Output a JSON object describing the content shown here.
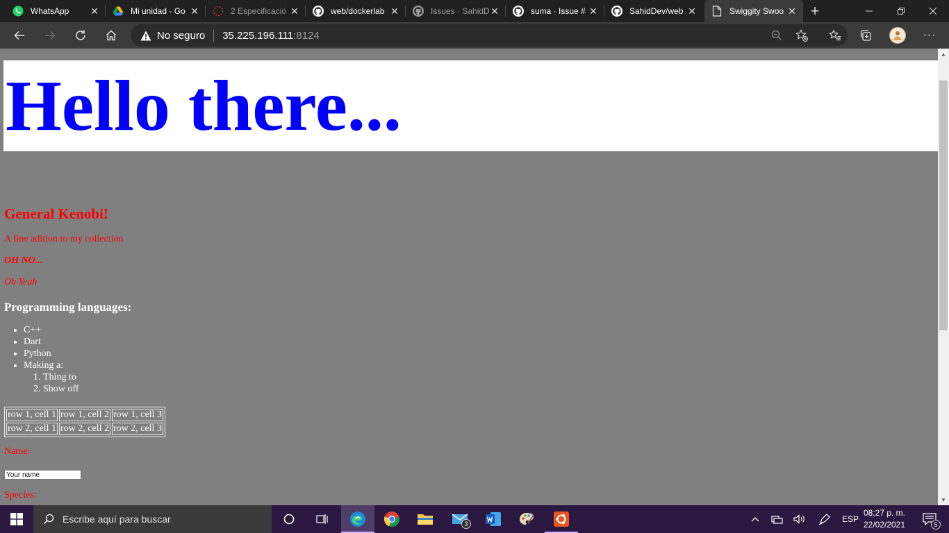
{
  "tabs": [
    {
      "title": "WhatsApp",
      "icon": "whatsapp-icon"
    },
    {
      "title": "Mi unidad - Go",
      "icon": "google-drive-icon"
    },
    {
      "title": "2 Especificació",
      "icon": "loading-spinner-icon"
    },
    {
      "title": "web/dockerlab",
      "icon": "github-icon"
    },
    {
      "title": "Issues · SahidD",
      "icon": "github-icon"
    },
    {
      "title": "suma · Issue #",
      "icon": "github-icon"
    },
    {
      "title": "SahidDev/web",
      "icon": "github-icon"
    },
    {
      "title": "Swiggity Swoo",
      "icon": "page-icon"
    }
  ],
  "address_bar": {
    "security_label": "No seguro",
    "url_host": "35.225.196.111",
    "url_port": ":8124"
  },
  "page": {
    "heading": "Hello there...",
    "subheading": "General Kenobi!",
    "paragraph1": "A fine adition to my collection",
    "paragraph2": "OH NO...",
    "paragraph3": "Oh Yeah",
    "languages_title": "Programming languages:",
    "languages": [
      "C++",
      "Dart",
      "Python",
      "Making a:"
    ],
    "making_items": [
      "Thing to",
      "Show off"
    ],
    "table": [
      [
        "row 1, cell 1",
        "row 1, cell 2",
        "row 1, cell 3"
      ],
      [
        "row 2, cell 1",
        "row 2, cell 2",
        "row 2, cell 3"
      ]
    ],
    "name_label": "Name:",
    "name_placeholder": "Your name",
    "species_label": "Species:"
  },
  "taskbar": {
    "search_placeholder": "Escribe aquí para buscar",
    "mail_badge": "3",
    "language": "ESP",
    "time": "08:27 p. m.",
    "date": "22/02/2021",
    "notifications_badge": "5"
  },
  "colors": {
    "page_background": "#808080",
    "heading_color": "#0000ff",
    "red_text": "#ff0000",
    "taskbar": "#2b1840"
  }
}
